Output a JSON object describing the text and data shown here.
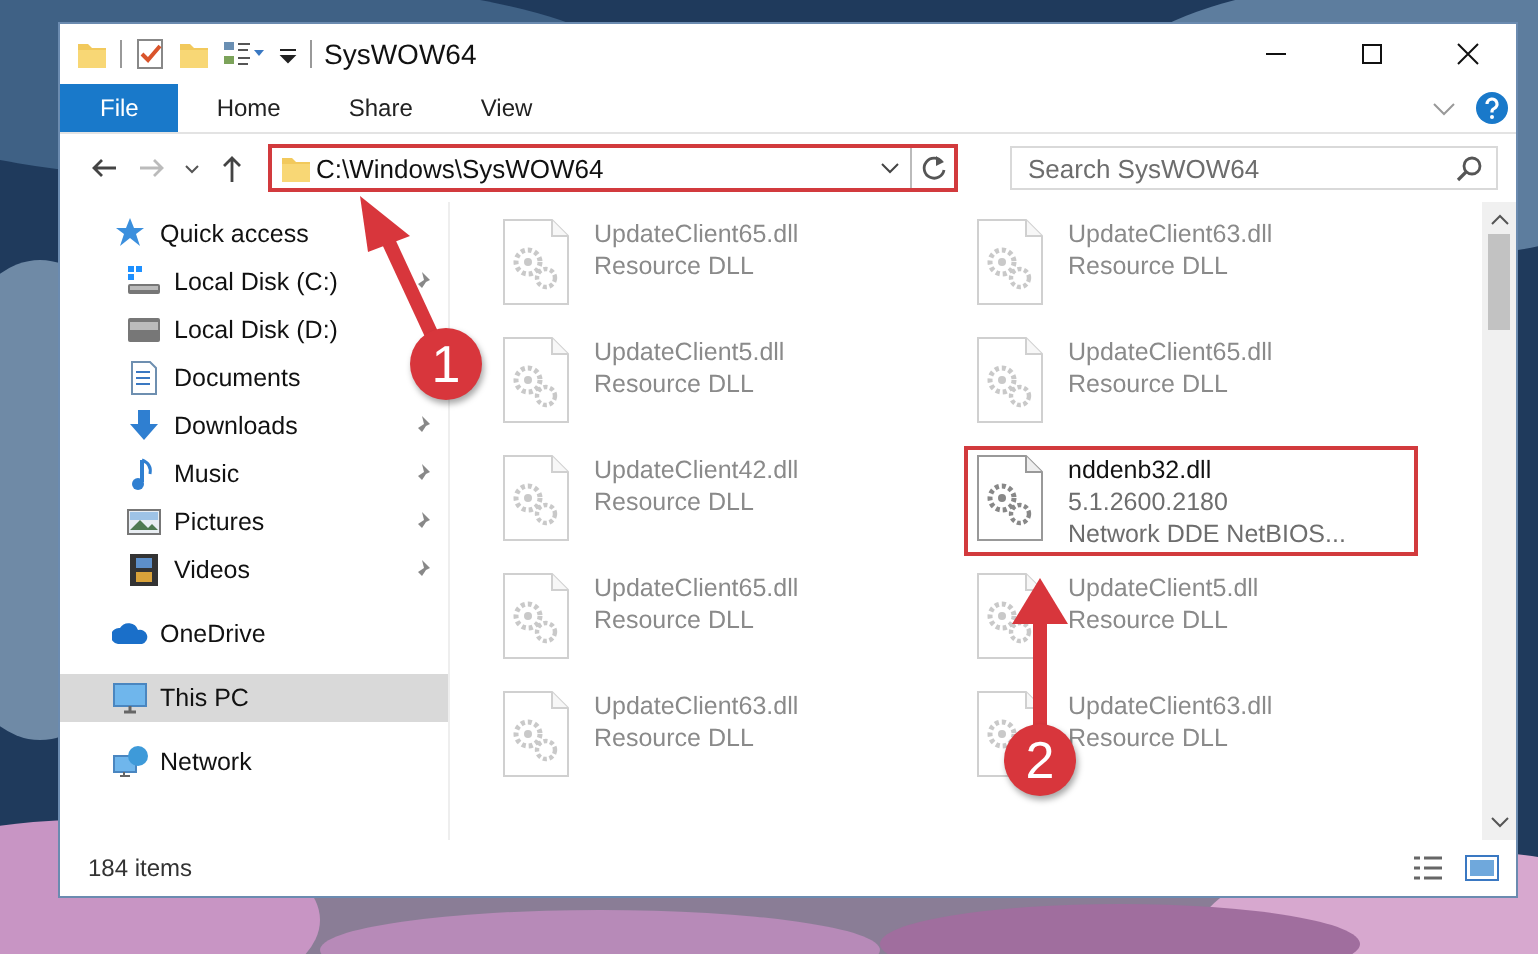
{
  "window": {
    "title": "SysWOW64"
  },
  "ribbon_tabs": [
    {
      "label": "File",
      "selected": true
    },
    {
      "label": "Home",
      "selected": false
    },
    {
      "label": "Share",
      "selected": false
    },
    {
      "label": "View",
      "selected": false
    }
  ],
  "address_bar": {
    "value": "C:\\Windows\\SysWOW64",
    "highlighted": true
  },
  "search": {
    "placeholder": "Search SysWOW64"
  },
  "sidebar": {
    "items": [
      {
        "label": "Quick access",
        "kind": "star",
        "selected": false,
        "children": [
          {
            "label": "Local Disk (C:)",
            "kind": "system-drive",
            "pinned": true,
            "selected": false
          },
          {
            "label": "Local Disk (D:)",
            "kind": "drive",
            "pinned": false,
            "selected": false
          },
          {
            "label": "Documents",
            "kind": "documents",
            "pinned": false,
            "selected": false
          },
          {
            "label": "Downloads",
            "kind": "downloads",
            "pinned": true,
            "selected": false
          },
          {
            "label": "Music",
            "kind": "music",
            "pinned": true,
            "selected": false
          },
          {
            "label": "Pictures",
            "kind": "pictures",
            "pinned": true,
            "selected": false
          },
          {
            "label": "Videos",
            "kind": "videos",
            "pinned": true,
            "selected": false
          }
        ]
      },
      {
        "label": "OneDrive",
        "kind": "cloud",
        "selected": false
      },
      {
        "label": "This PC",
        "kind": "computer",
        "selected": true
      },
      {
        "label": "Network",
        "kind": "network",
        "selected": false
      }
    ]
  },
  "files": [
    {
      "name": "UpdateClient65.dll",
      "details": [
        "Resource DLL"
      ],
      "blurred": true,
      "highlighted": false
    },
    {
      "name": "UpdateClient63.dll",
      "details": [
        "Resource DLL"
      ],
      "blurred": true,
      "highlighted": false
    },
    {
      "name": "UpdateClient5.dll",
      "details": [
        "Resource DLL"
      ],
      "blurred": true,
      "highlighted": false
    },
    {
      "name": "UpdateClient65.dll",
      "details": [
        "Resource DLL"
      ],
      "blurred": true,
      "highlighted": false
    },
    {
      "name": "UpdateClient42.dll",
      "details": [
        "Resource DLL"
      ],
      "blurred": true,
      "highlighted": false
    },
    {
      "name": "nddenb32.dll",
      "details": [
        "5.1.2600.2180",
        "Network DDE NetBIOS..."
      ],
      "blurred": false,
      "highlighted": true
    },
    {
      "name": "UpdateClient65.dll",
      "details": [
        "Resource DLL"
      ],
      "blurred": true,
      "highlighted": false
    },
    {
      "name": "UpdateClient5.dll",
      "details": [
        "Resource DLL"
      ],
      "blurred": true,
      "highlighted": false
    },
    {
      "name": "UpdateClient63.dll",
      "details": [
        "Resource DLL"
      ],
      "blurred": true,
      "highlighted": false
    },
    {
      "name": "UpdateClient63.dll",
      "details": [
        "Resource DLL"
      ],
      "blurred": true,
      "highlighted": false
    }
  ],
  "status_bar": {
    "item_count": "184 items"
  },
  "annotations": [
    {
      "label": "1"
    },
    {
      "label": "2"
    }
  ]
}
